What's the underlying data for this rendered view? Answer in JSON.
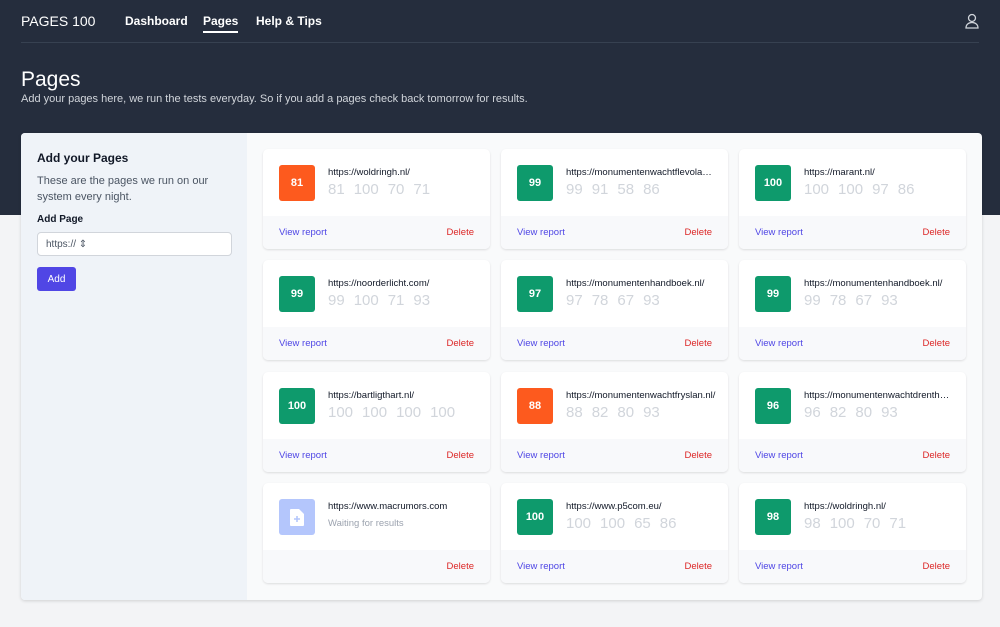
{
  "nav": {
    "logo": "PAGES 100",
    "links": [
      "Dashboard",
      "Pages",
      "Help & Tips"
    ],
    "active": "Pages"
  },
  "header": {
    "title": "Pages",
    "subtitle": "Add your pages here, we run the tests everyday. So if you add a pages check back tomorrow for results."
  },
  "sidebar": {
    "title": "Add your Pages",
    "description": "These are the pages we run on our system every night.",
    "field_label": "Add Page",
    "input_value": "https:// ⇕",
    "button": "Add"
  },
  "colors": {
    "orange": "#fd5a1e",
    "green": "#0e9a6c",
    "pending": "#b4c6fc",
    "accent": "#5046e5"
  },
  "labels": {
    "view": "View report",
    "delete": "Delete",
    "waiting": "Waiting for results"
  },
  "pages": [
    {
      "url": "https://woldringh.nl/",
      "score": 81,
      "status": "orange",
      "scores": [
        81,
        100,
        70,
        71
      ]
    },
    {
      "url": "https://monumentenwachtflevoland.nl/",
      "score": 99,
      "status": "green",
      "scores": [
        99,
        91,
        58,
        86
      ]
    },
    {
      "url": "https://marant.nl/",
      "score": 100,
      "status": "green",
      "scores": [
        100,
        100,
        97,
        86
      ]
    },
    {
      "url": "https://noorderlicht.com/",
      "score": 99,
      "status": "green",
      "scores": [
        99,
        100,
        71,
        93
      ]
    },
    {
      "url": "https://monumentenhandboek.nl/",
      "score": 97,
      "status": "green",
      "scores": [
        97,
        78,
        67,
        93
      ]
    },
    {
      "url": "https://monumentenhandboek.nl/",
      "score": 99,
      "status": "green",
      "scores": [
        99,
        78,
        67,
        93
      ]
    },
    {
      "url": "https://bartligthart.nl/",
      "score": 100,
      "status": "green",
      "scores": [
        100,
        100,
        100,
        100
      ]
    },
    {
      "url": "https://monumentenwachtfryslan.nl/",
      "score": 88,
      "status": "orange",
      "scores": [
        88,
        82,
        80,
        93
      ]
    },
    {
      "url": "https://monumentenwachtdrenthe.nl/",
      "score": 96,
      "status": "green",
      "scores": [
        96,
        82,
        80,
        93
      ]
    },
    {
      "url": "https://www.macrumors.com",
      "score": null,
      "status": "pending",
      "scores": []
    },
    {
      "url": "https://www.p5com.eu/",
      "score": 100,
      "status": "green",
      "scores": [
        100,
        100,
        65,
        86
      ]
    },
    {
      "url": "https://woldringh.nl/",
      "score": 98,
      "status": "green",
      "scores": [
        98,
        100,
        70,
        71
      ]
    }
  ]
}
